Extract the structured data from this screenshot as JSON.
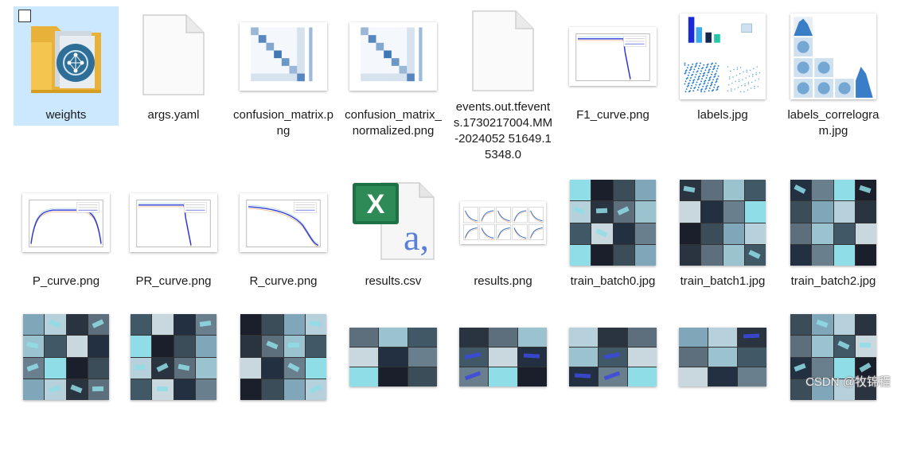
{
  "files": [
    {
      "row": 0,
      "col": 0,
      "name": "weights",
      "kind": "folder",
      "selected": true
    },
    {
      "row": 0,
      "col": 1,
      "name": "args.yaml",
      "kind": "blank"
    },
    {
      "row": 0,
      "col": 2,
      "name": "confusion_matrix.png",
      "kind": "matrix"
    },
    {
      "row": 0,
      "col": 3,
      "name": "confusion_matrix_normalized.png",
      "kind": "matrix"
    },
    {
      "row": 0,
      "col": 4,
      "name": "events.out.tfevents.1730217004.MM-2024052 51649.15348.0",
      "kind": "blank"
    },
    {
      "row": 0,
      "col": 5,
      "name": "F1_curve.png",
      "kind": "curve"
    },
    {
      "row": 0,
      "col": 6,
      "name": "labels.jpg",
      "kind": "labels"
    },
    {
      "row": 0,
      "col": 7,
      "name": "labels_correlogram.jpg",
      "kind": "correlogram"
    },
    {
      "row": 1,
      "col": 0,
      "name": "P_curve.png",
      "kind": "curve"
    },
    {
      "row": 1,
      "col": 1,
      "name": "PR_curve.png",
      "kind": "curve"
    },
    {
      "row": 1,
      "col": 2,
      "name": "R_curve.png",
      "kind": "curve"
    },
    {
      "row": 1,
      "col": 3,
      "name": "results.csv",
      "kind": "excel"
    },
    {
      "row": 1,
      "col": 4,
      "name": "results.png",
      "kind": "results"
    },
    {
      "row": 1,
      "col": 5,
      "name": "train_batch0.jpg",
      "kind": "batch"
    },
    {
      "row": 1,
      "col": 6,
      "name": "train_batch1.jpg",
      "kind": "batch"
    },
    {
      "row": 1,
      "col": 7,
      "name": "train_batch2.jpg",
      "kind": "batch"
    },
    {
      "row": 2,
      "col": 0,
      "name": "",
      "kind": "batch"
    },
    {
      "row": 2,
      "col": 1,
      "name": "",
      "kind": "batch"
    },
    {
      "row": 2,
      "col": 2,
      "name": "",
      "kind": "batch"
    },
    {
      "row": 2,
      "col": 3,
      "name": "",
      "kind": "val"
    },
    {
      "row": 2,
      "col": 4,
      "name": "",
      "kind": "val"
    },
    {
      "row": 2,
      "col": 5,
      "name": "",
      "kind": "val"
    },
    {
      "row": 2,
      "col": 6,
      "name": "",
      "kind": "val"
    },
    {
      "row": 2,
      "col": 7,
      "name": "",
      "kind": "batch"
    }
  ],
  "watermark": "CSDN @牧锦程",
  "colors": {
    "selection": "#cce8ff",
    "folder": "#f5c64f",
    "excel": "#1e7145"
  }
}
